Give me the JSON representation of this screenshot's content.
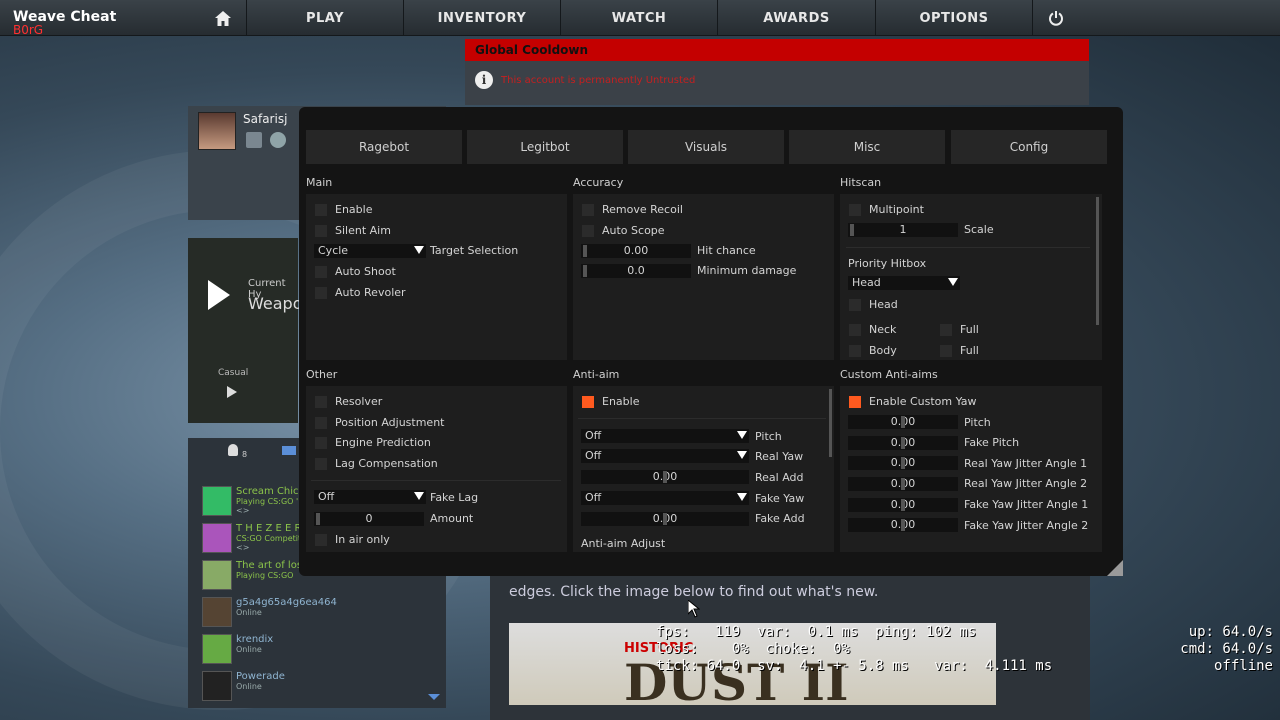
{
  "brand": {
    "title": "Weave Cheat",
    "subtitle": "B0rG"
  },
  "nav": {
    "play": "PLAY",
    "inventory": "INVENTORY",
    "watch": "WATCH",
    "awards": "AWARDS",
    "options": "OPTIONS"
  },
  "notice": {
    "title": "Global Cooldown",
    "message": "This account is permanently Untrusted"
  },
  "profile": {
    "name": "Safarisj"
  },
  "video": {
    "line1": "Current Hy",
    "line2": "Weapo",
    "mode": "Casual"
  },
  "friends": {
    "count": "8",
    "list": [
      {
        "name": "Scream Chic",
        "status": "Playing CS:GO 'H",
        "extra": "<>"
      },
      {
        "name": "T H E Z E E R",
        "status": "CS:GO Competiti",
        "extra": "<>"
      },
      {
        "name": "The art of los",
        "status": "Playing CS:GO",
        "extra": ""
      },
      {
        "name": "g5a4g65a4g6ea464",
        "status": "Online",
        "extra": ""
      },
      {
        "name": "krendix",
        "status": "Online",
        "extra": ""
      },
      {
        "name": "Powerade",
        "status": "Online",
        "extra": ""
      }
    ]
  },
  "news": {
    "text": "edges. Click the image below to find out what's new.",
    "hist": "HISTORIC",
    "dust": "DUST II"
  },
  "netgraph": {
    "l1": "fps:   119  var:  0.1 ms  ping: 102 ms",
    "l2": "loss:    0%  choke:  0%",
    "l3": "tick: 64.0  sv:  4.1 +- 5.8 ms   var:  4.111 ms",
    "r1": "up: 64.0/s",
    "r2": "cmd: 64.0/s",
    "r3": "offline"
  },
  "tabs": {
    "ragebot": "Ragebot",
    "legitbot": "Legitbot",
    "visuals": "Visuals",
    "misc": "Misc",
    "config": "Config"
  },
  "main": {
    "title": "Main",
    "enable": "Enable",
    "silent": "Silent Aim",
    "target_value": "Cycle",
    "target_label": "Target Selection",
    "autoshoot": "Auto Shoot",
    "autorevolver": "Auto Revoler"
  },
  "accuracy": {
    "title": "Accuracy",
    "remove_recoil": "Remove Recoil",
    "auto_scope": "Auto Scope",
    "hitchance_value": "0.00",
    "hitchance_label": "Hit chance",
    "mindmg_value": "0.0",
    "mindmg_label": "Minimum damage"
  },
  "hitscan": {
    "title": "Hitscan",
    "multipoint": "Multipoint",
    "scale_value": "1",
    "scale_label": "Scale",
    "priority_label": "Priority Hitbox",
    "priority_value": "Head",
    "head": "Head",
    "neck": "Neck",
    "body": "Body",
    "full1": "Full",
    "full2": "Full"
  },
  "other": {
    "title": "Other",
    "resolver": "Resolver",
    "posadj": "Position Adjustment",
    "engine": "Engine Prediction",
    "lagcomp": "Lag Compensation",
    "fakelag_value": "Off",
    "fakelag_label": "Fake Lag",
    "amount_value": "0",
    "amount_label": "Amount",
    "inair": "In air only"
  },
  "antiaim": {
    "title": "Anti-aim",
    "enable": "Enable",
    "pitch_value": "Off",
    "pitch_label": "Pitch",
    "realyaw_value": "Off",
    "realyaw_label": "Real Yaw",
    "realadd_value": "0.00",
    "realadd_label": "Real Add",
    "fakeyaw_value": "Off",
    "fakeyaw_label": "Fake Yaw",
    "fakeadd_value": "0.00",
    "fakeadd_label": "Fake Add",
    "adjust": "Anti-aim Adjust"
  },
  "custom": {
    "title": "Custom Anti-aims",
    "enable": "Enable Custom Yaw",
    "rows": [
      {
        "value": "0.00",
        "label": "Pitch"
      },
      {
        "value": "0.00",
        "label": "Fake Pitch"
      },
      {
        "value": "0.00",
        "label": "Real Yaw Jitter Angle 1"
      },
      {
        "value": "0.00",
        "label": "Real Yaw Jitter Angle 2"
      },
      {
        "value": "0.00",
        "label": "Fake Yaw Jitter Angle 1"
      },
      {
        "value": "0.00",
        "label": "Fake Yaw Jitter Angle 2"
      }
    ]
  },
  "colors": {
    "accent": "#ff5a1f",
    "notice": "#c40000"
  }
}
